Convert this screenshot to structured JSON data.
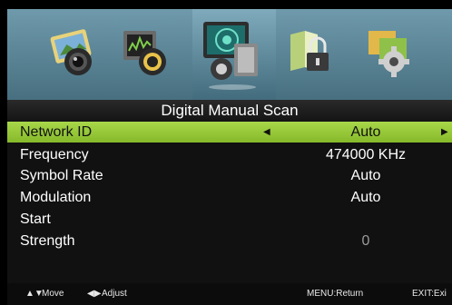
{
  "menu": {
    "title": "Digital Manual Scan",
    "rows": [
      {
        "label": "Network ID",
        "value": "Auto",
        "selected": true
      },
      {
        "label": "Frequency",
        "value": "474000 KHz"
      },
      {
        "label": "Symbol Rate",
        "value": "Auto"
      },
      {
        "label": "Modulation",
        "value": "Auto"
      },
      {
        "label": "Start",
        "value": ""
      },
      {
        "label": "Strength",
        "value": "0"
      }
    ]
  },
  "icons": [
    {
      "name": "picture-icon"
    },
    {
      "name": "sound-icon"
    },
    {
      "name": "channel-icon",
      "selected": true
    },
    {
      "name": "lock-icon"
    },
    {
      "name": "setup-icon"
    }
  ],
  "footer": {
    "move": "Move",
    "adjust": "Adjust",
    "menu": "MENU:Return",
    "exit": "EXIT:Exi"
  },
  "colors": {
    "highlight": "#9ccc3d",
    "band": "#5d8798",
    "title_bar": "#1e1e1e"
  }
}
